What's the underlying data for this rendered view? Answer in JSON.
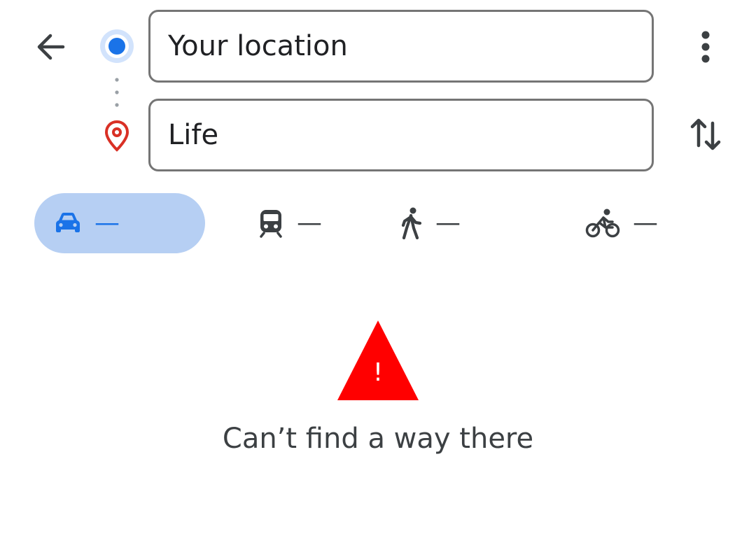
{
  "header": {
    "back_icon": "arrow-left-icon",
    "more_icon": "more-vert-icon",
    "swap_icon": "swap-vert-icon"
  },
  "route": {
    "origin": {
      "value": "Your location",
      "icon": "origin-dot-icon"
    },
    "destination": {
      "value": "Life",
      "icon": "place-pin-icon"
    }
  },
  "modes": [
    {
      "name": "drive",
      "icon": "car-icon",
      "value": "—",
      "selected": true
    },
    {
      "name": "transit",
      "icon": "train-icon",
      "value": "—",
      "selected": false
    },
    {
      "name": "walk",
      "icon": "walk-icon",
      "value": "—",
      "selected": false
    },
    {
      "name": "bike",
      "icon": "bike-icon",
      "value": "—",
      "selected": false
    }
  ],
  "status": {
    "icon": "warning-triangle-icon",
    "icon_glyph": "!",
    "message": "Can’t find a way there"
  },
  "colors": {
    "accent": "#1a73e8",
    "selected_mode_bg": "#b6cff3",
    "destination_pin": "#d93025",
    "warning": "#ff0000",
    "text": "#3c4043",
    "field_border": "#757575"
  }
}
